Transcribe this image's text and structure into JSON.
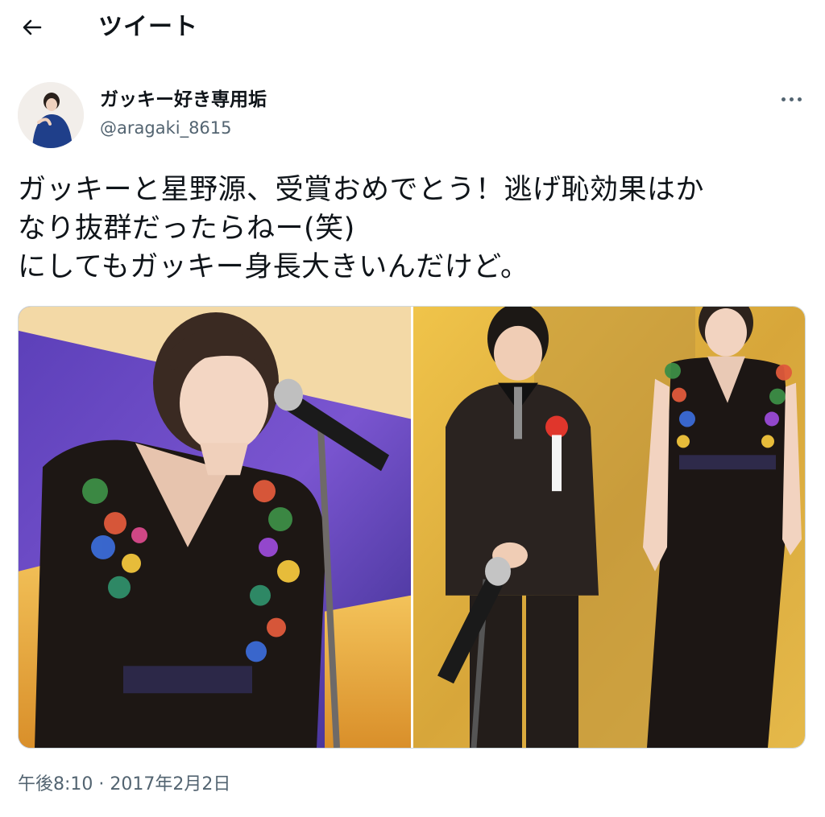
{
  "header": {
    "title": "ツイート",
    "back_icon": "arrow-left-icon"
  },
  "author": {
    "display_name": "ガッキー好き専用垢",
    "handle": "@aragaki_8615"
  },
  "more_icon": "more-horizontal-icon",
  "tweet": {
    "lines": [
      "ガッキーと星野源、受賞おめでとう！逃げ恥効果はか",
      "なり抜群だったらねー(笑)",
      "にしてもガッキー身長大きいんだけど。"
    ]
  },
  "media": {
    "photo_count": 2
  },
  "timestamp": "午後8:10 · 2017年2月2日",
  "colors": {
    "text": "#0f1419",
    "secondary": "#536471",
    "border": "#cfd9de"
  }
}
